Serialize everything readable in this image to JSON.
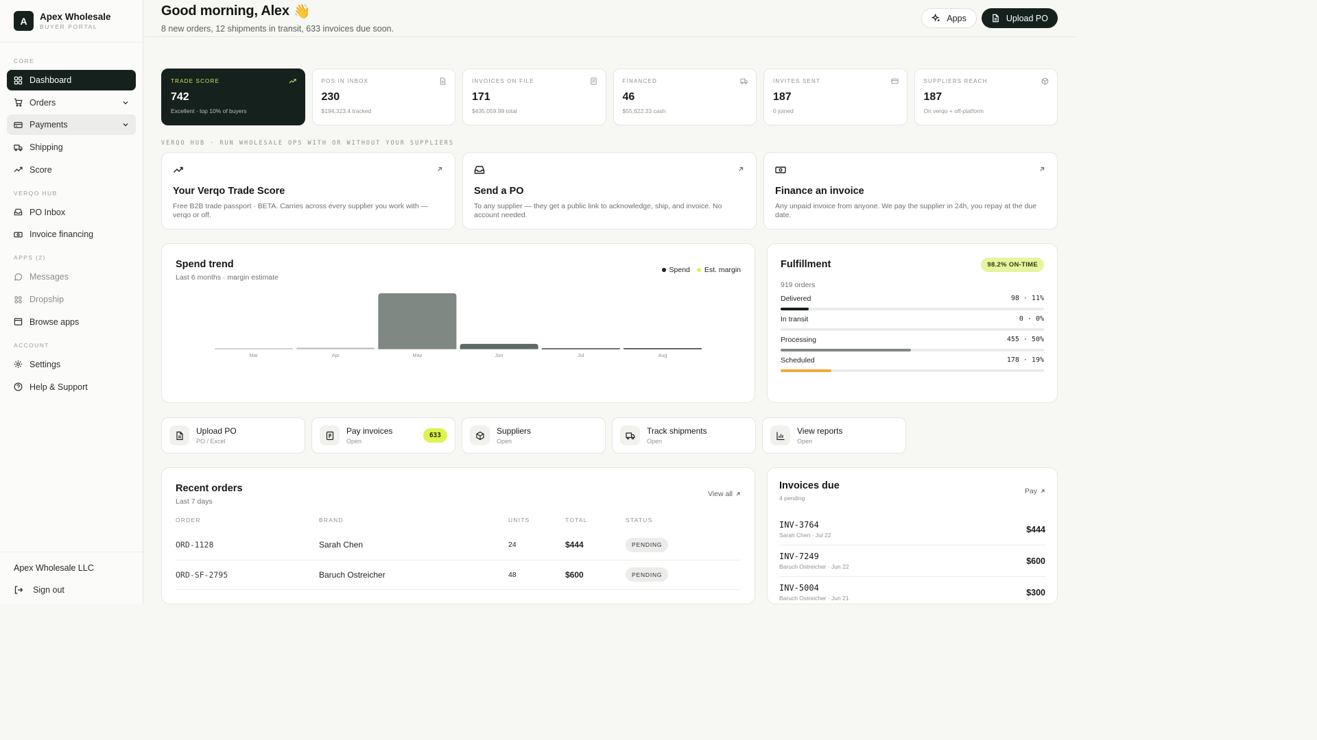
{
  "brand": {
    "initial": "A",
    "name": "Apex Wholesale",
    "subtitle": "BUYER PORTAL"
  },
  "nav": {
    "sections": [
      {
        "label": "CORE"
      },
      {
        "label": "VERQO HUB"
      },
      {
        "label": "APPS  (2)"
      },
      {
        "label": "ACCOUNT"
      }
    ],
    "items": [
      {
        "label": "Dashboard",
        "icon": "grid-icon",
        "state": "active"
      },
      {
        "label": "Orders",
        "icon": "cart-icon",
        "expandable": true
      },
      {
        "label": "Payments",
        "icon": "card-icon",
        "expandable": true,
        "state": "hover"
      },
      {
        "label": "Shipping",
        "icon": "truck-icon"
      },
      {
        "label": "Score",
        "icon": "trend-icon"
      },
      {
        "label": "PO Inbox",
        "icon": "inbox-icon"
      },
      {
        "label": "Invoice financing",
        "icon": "banknote-icon"
      },
      {
        "label": "Messages",
        "icon": "chat-icon",
        "state": "muted"
      },
      {
        "label": "Dropship",
        "icon": "nodes-icon",
        "state": "muted"
      },
      {
        "label": "Browse apps",
        "icon": "window-icon"
      },
      {
        "label": "Settings",
        "icon": "gear-icon"
      },
      {
        "label": "Help & Support",
        "icon": "help-icon"
      }
    ]
  },
  "footer": {
    "company": "Apex Wholesale LLC",
    "signout": "Sign out"
  },
  "header": {
    "greeting": "Good morning, Alex",
    "emoji": "👋",
    "summary": "8 new orders, 12 shipments in transit, 633 invoices due soon.",
    "apps_label": "Apps",
    "upload_label": "Upload PO"
  },
  "kpis": [
    {
      "label": "TRADE SCORE",
      "value": "742",
      "sub": "Excellent · top 10% of buyers",
      "icon": "trend-up-icon"
    },
    {
      "label": "POS IN INBOX",
      "value": "230",
      "sub": "$194,323.4 tracked",
      "icon": "document-icon"
    },
    {
      "label": "INVOICES ON FILE",
      "value": "171",
      "sub": "$435,059.99 total",
      "icon": "receipt-icon"
    },
    {
      "label": "FINANCED",
      "value": "46",
      "sub": "$55,622.33 cash",
      "icon": "truck-icon"
    },
    {
      "label": "INVITES SENT",
      "value": "187",
      "sub": "0 joined",
      "icon": "card-icon"
    },
    {
      "label": "SUPPLIERS REACH",
      "value": "187",
      "sub": "On verqo + off-platform",
      "icon": "package-icon"
    }
  ],
  "hub": {
    "label": "VERQO HUB · RUN WHOLESALE OPS WITH OR WITHOUT YOUR SUPPLIERS",
    "cards": [
      {
        "title": "Your Verqo Trade Score",
        "desc": "Free B2B trade passport · BETA. Carries across every supplier you work with — verqo or off.",
        "icon": "trend-up-icon"
      },
      {
        "title": "Send a PO",
        "desc": "To any supplier — they get a public link to acknowledge, ship, and invoice. No account needed.",
        "icon": "inbox-icon"
      },
      {
        "title": "Finance an invoice",
        "desc": "Any unpaid invoice from anyone. We pay the supplier in 24h, you repay at the due date.",
        "icon": "banknote-icon"
      }
    ]
  },
  "spend": {
    "title": "Spend trend",
    "subtitle": "Last 6 months · margin estimate",
    "legend_spend": "Spend",
    "legend_margin": "Est. margin",
    "colors": {
      "spend": "#7f8882",
      "spend_dark": "#5f6a64",
      "margin": "#dff34f",
      "legend_dot": "#15211d"
    }
  },
  "chart_data": {
    "type": "bar",
    "categories": [
      "Mar",
      "Apr",
      "May",
      "Jun",
      "Jul",
      "Aug"
    ],
    "values": [
      1.2,
      2.5,
      100,
      9.5,
      1.0,
      1.8
    ],
    "ylim": [
      0,
      100
    ],
    "grid": false,
    "legend": "top-right"
  },
  "fulfillment": {
    "title": "Fulfillment",
    "badge": "98.2% ON-TIME",
    "orders": "919 orders",
    "rows": [
      {
        "label": "Delivered",
        "count": "98",
        "pct": "11%",
        "fill": 0.107,
        "color": "#15211d"
      },
      {
        "label": "In transit",
        "count": "0",
        "pct": "0%",
        "fill": 0,
        "color": "#15211d"
      },
      {
        "label": "Processing",
        "count": "455",
        "pct": "50%",
        "fill": 0.495,
        "color": "#7f8882"
      },
      {
        "label": "Scheduled",
        "count": "178",
        "pct": "19%",
        "fill": 0.194,
        "color": "#f2a93b"
      }
    ]
  },
  "quick": [
    {
      "title": "Upload PO",
      "sub": "PO / Excel",
      "icon": "document-icon"
    },
    {
      "title": "Pay invoices",
      "sub": "Open",
      "icon": "receipt-icon",
      "badge": "633"
    },
    {
      "title": "Suppliers",
      "sub": "Open",
      "icon": "package-icon"
    },
    {
      "title": "Track shipments",
      "sub": "Open",
      "icon": "truck-icon"
    },
    {
      "title": "View reports",
      "sub": "Open",
      "icon": "bar-chart-icon"
    }
  ],
  "orders": {
    "title": "Recent orders",
    "subtitle": "Last 7 days",
    "view_all": "View all",
    "columns": [
      "ORDER",
      "BRAND",
      "UNITS",
      "TOTAL",
      "STATUS"
    ],
    "rows": [
      {
        "order": "ORD-1128",
        "brand": "Sarah Chen",
        "units": "24",
        "total": "$444",
        "status": "PENDING"
      },
      {
        "order": "ORD-SF-2795",
        "brand": "Baruch Ostreicher",
        "units": "48",
        "total": "$600",
        "status": "PENDING"
      }
    ]
  },
  "invoices": {
    "title": "Invoices due",
    "subtitle": "4 pending",
    "pay": "Pay",
    "items": [
      {
        "id": "INV-3764",
        "meta": "Sarah Chen · Jul 22",
        "amount": "$444"
      },
      {
        "id": "INV-7249",
        "meta": "Baruch Ostreicher · Jun 22",
        "amount": "$600"
      },
      {
        "id": "INV-5004",
        "meta": "Baruch Ostreicher · Jun 21",
        "amount": "$300"
      }
    ]
  }
}
